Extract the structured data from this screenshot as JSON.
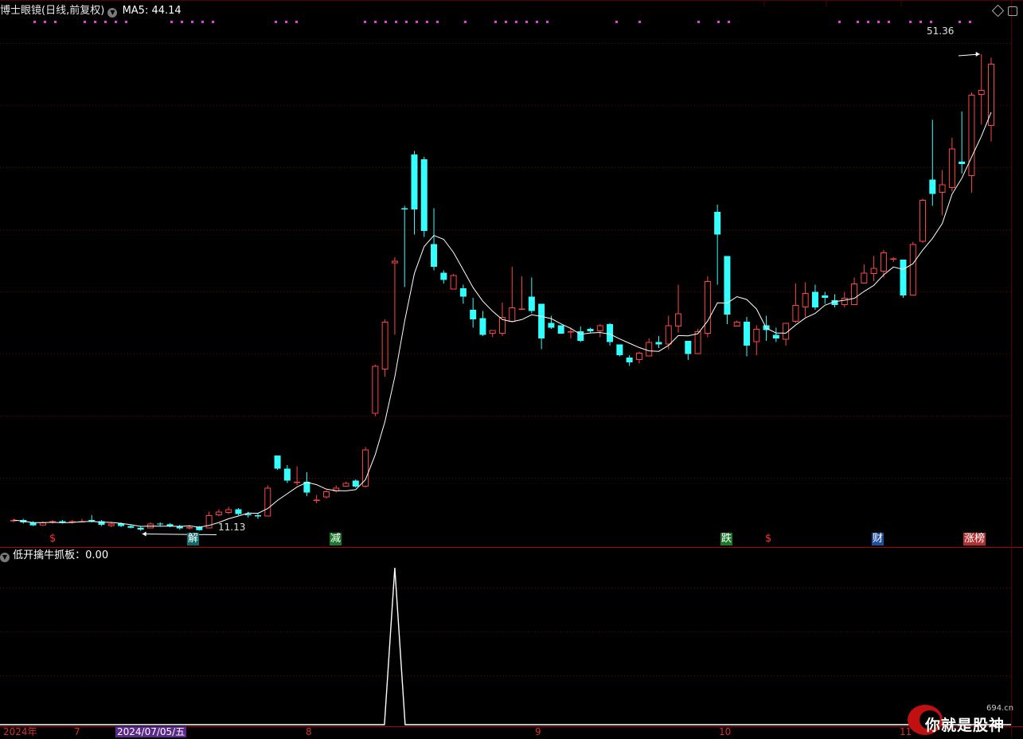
{
  "header": {
    "indicator_name": "博士眼镜(日线,前复权)",
    "ma_label": "MA5: 44.14",
    "panel2_label": "低开擒牛抓板：0.00"
  },
  "price_labels": {
    "high": "51.36",
    "low": "11.13"
  },
  "event_tags": [
    {
      "text": "$",
      "color": "#ff3333",
      "bg": "none"
    },
    {
      "text": "解",
      "color": "#ffffff",
      "bg": "#0b6b6b"
    },
    {
      "text": "减",
      "color": "#ffffff",
      "bg": "#1a7a2a"
    },
    {
      "text": "跌",
      "color": "#ffffff",
      "bg": "#1a7a2a"
    },
    {
      "text": "$",
      "color": "#ff3333",
      "bg": "none"
    },
    {
      "text": "财",
      "color": "#ffffff",
      "bg": "#1e4fa0"
    },
    {
      "text": "涨榜",
      "color": "#ffffff",
      "bg": "#b03030"
    }
  ],
  "x_axis": {
    "labels": [
      "2024年",
      "7",
      "2024/07/05/五",
      "8",
      "9",
      "10",
      "11"
    ],
    "cursor_date": "2024/07/05/五"
  },
  "watermark": {
    "text": "你就是股神",
    "domain": "694.cn"
  },
  "colors": {
    "up": "#ff4444",
    "down": "#33ffff",
    "ma": "#ffffff",
    "grid": "#7a0000",
    "magenta": "#e040e0",
    "signal": "#ffffff"
  },
  "chart_data": {
    "type": "candlestick",
    "price_range": [
      9.5,
      52.5
    ],
    "ma_name": "MA5",
    "ma_value": 44.14,
    "high_marker": 51.36,
    "low_marker": 11.13,
    "candles": [
      [
        11.4,
        11.6,
        11.3,
        11.5
      ],
      [
        11.5,
        11.6,
        11.2,
        11.3
      ],
      [
        11.3,
        11.4,
        11.0,
        11.05
      ],
      [
        11.05,
        11.4,
        11.0,
        11.3
      ],
      [
        11.3,
        11.5,
        11.2,
        11.4
      ],
      [
        11.4,
        11.5,
        11.2,
        11.3
      ],
      [
        11.3,
        11.5,
        11.2,
        11.4
      ],
      [
        11.4,
        11.6,
        11.3,
        11.4
      ],
      [
        11.5,
        11.9,
        11.3,
        11.4
      ],
      [
        11.4,
        11.5,
        11.0,
        11.1
      ],
      [
        11.0,
        11.3,
        10.9,
        11.2
      ],
      [
        11.2,
        11.3,
        10.9,
        11.0
      ],
      [
        11.0,
        11.1,
        10.8,
        10.85
      ],
      [
        10.85,
        11.0,
        10.6,
        10.7
      ],
      [
        10.8,
        11.3,
        10.8,
        11.2
      ],
      [
        11.2,
        11.3,
        11.0,
        11.15
      ],
      [
        11.15,
        11.25,
        10.9,
        11.0
      ],
      [
        11.0,
        11.1,
        10.7,
        10.8
      ],
      [
        10.8,
        11.1,
        10.7,
        10.9
      ],
      [
        10.9,
        11.0,
        10.6,
        10.65
      ],
      [
        10.8,
        12.2,
        10.8,
        11.9
      ],
      [
        11.9,
        12.4,
        11.8,
        12.2
      ],
      [
        12.1,
        12.6,
        12.0,
        12.4
      ],
      [
        12.4,
        12.5,
        11.9,
        12.0
      ],
      [
        12.0,
        12.2,
        11.7,
        11.9
      ],
      [
        11.9,
        12.1,
        11.6,
        11.8
      ],
      [
        11.8,
        14.4,
        11.8,
        14.2
      ],
      [
        16.9,
        16.9,
        15.7,
        15.8
      ],
      [
        15.8,
        16.1,
        14.6,
        14.8
      ],
      [
        14.7,
        16.0,
        14.4,
        14.7
      ],
      [
        14.7,
        15.5,
        13.5,
        13.8
      ],
      [
        13.2,
        13.6,
        12.9,
        13.2
      ],
      [
        13.4,
        14.0,
        13.3,
        13.9
      ],
      [
        13.9,
        14.4,
        13.8,
        14.2
      ],
      [
        14.3,
        14.7,
        14.3,
        14.6
      ],
      [
        14.8,
        14.9,
        14.2,
        14.3
      ],
      [
        14.3,
        17.6,
        14.2,
        17.4
      ],
      [
        20.4,
        24.5,
        20.2,
        24.4
      ],
      [
        24.1,
        28.3,
        23.5,
        28.1
      ],
      [
        33.0,
        33.5,
        27.0,
        33.2
      ],
      [
        37.6,
        37.8,
        31.0,
        37.5
      ],
      [
        42.1,
        42.4,
        35.4,
        37.5
      ],
      [
        41.7,
        41.9,
        35.2,
        35.7
      ],
      [
        34.6,
        37.6,
        32.4,
        32.7
      ],
      [
        32.2,
        32.4,
        31.3,
        31.6
      ],
      [
        30.8,
        32.1,
        30.8,
        32.0
      ],
      [
        30.9,
        31.2,
        29.6,
        30.2
      ],
      [
        29.1,
        30.1,
        27.6,
        28.3
      ],
      [
        28.4,
        29.0,
        26.9,
        27.0
      ],
      [
        27.1,
        27.4,
        26.8,
        27.4
      ],
      [
        27.1,
        29.7,
        26.9,
        28.5
      ],
      [
        28.1,
        32.7,
        28.1,
        29.3
      ],
      [
        29.2,
        31.9,
        29.2,
        29.2
      ],
      [
        30.2,
        31.8,
        28.8,
        29.0
      ],
      [
        29.6,
        29.6,
        25.8,
        26.7
      ],
      [
        28.0,
        28.6,
        27.5,
        27.6
      ],
      [
        27.8,
        27.8,
        27.1,
        27.1
      ],
      [
        27.3,
        27.6,
        26.7,
        27.3
      ],
      [
        27.3,
        27.7,
        26.4,
        26.5
      ],
      [
        27.5,
        27.6,
        27.2,
        27.3
      ],
      [
        27.3,
        27.9,
        26.8,
        27.8
      ],
      [
        27.9,
        28.0,
        26.1,
        26.4
      ],
      [
        26.2,
        26.2,
        25.2,
        25.3
      ],
      [
        25.1,
        25.3,
        24.4,
        24.7
      ],
      [
        24.9,
        25.6,
        24.6,
        25.5
      ],
      [
        25.2,
        26.7,
        25.2,
        26.4
      ],
      [
        26.4,
        26.9,
        25.9,
        26.2
      ],
      [
        26.2,
        28.6,
        25.8,
        27.8
      ],
      [
        27.7,
        31.2,
        27.2,
        28.8
      ],
      [
        26.5,
        26.5,
        24.9,
        25.4
      ],
      [
        25.4,
        27.5,
        25.4,
        27.3
      ],
      [
        27.1,
        31.9,
        26.8,
        31.5
      ],
      [
        37.3,
        37.9,
        31.2,
        35.4
      ],
      [
        33.6,
        33.6,
        27.9,
        28.7
      ],
      [
        27.7,
        28.2,
        27.8,
        28.1
      ],
      [
        28.1,
        28.5,
        25.2,
        26.1
      ],
      [
        26.4,
        27.8,
        25.3,
        27.5
      ],
      [
        27.8,
        28.6,
        26.5,
        27.4
      ],
      [
        27.0,
        27.6,
        26.4,
        26.7
      ],
      [
        26.6,
        28.0,
        26.1,
        28.0
      ],
      [
        28.1,
        31.3,
        28.0,
        29.5
      ],
      [
        29.3,
        31.4,
        28.5,
        30.5
      ],
      [
        30.6,
        31.2,
        29.1,
        29.3
      ],
      [
        30.3,
        30.6,
        29.6,
        30.1
      ],
      [
        29.9,
        30.4,
        29.3,
        29.5
      ],
      [
        29.5,
        30.6,
        29.3,
        30.1
      ],
      [
        29.5,
        31.8,
        29.5,
        31.3
      ],
      [
        31.3,
        32.9,
        31.3,
        32.2
      ],
      [
        32.1,
        33.6,
        31.5,
        32.6
      ],
      [
        32.3,
        34.1,
        31.8,
        33.9
      ],
      [
        33.4,
        33.5,
        33.1,
        33.4
      ],
      [
        33.3,
        33.3,
        30.1,
        30.3
      ],
      [
        30.3,
        34.8,
        30.3,
        34.6
      ],
      [
        34.8,
        38.4,
        34.7,
        38.3
      ],
      [
        40.0,
        45.0,
        37.8,
        38.8
      ],
      [
        38.9,
        40.8,
        37.0,
        39.6
      ],
      [
        39.3,
        43.5,
        39.0,
        42.6
      ],
      [
        41.5,
        45.7,
        40.5,
        41.3
      ],
      [
        40.3,
        47.3,
        38.9,
        47.1
      ],
      [
        47.1,
        50.5,
        44.6,
        47.5
      ],
      [
        44.5,
        50.2,
        43.2,
        49.7
      ]
    ],
    "signal": {
      "range": [
        0,
        1
      ],
      "peak_index": 39,
      "peak_value": 1
    }
  }
}
